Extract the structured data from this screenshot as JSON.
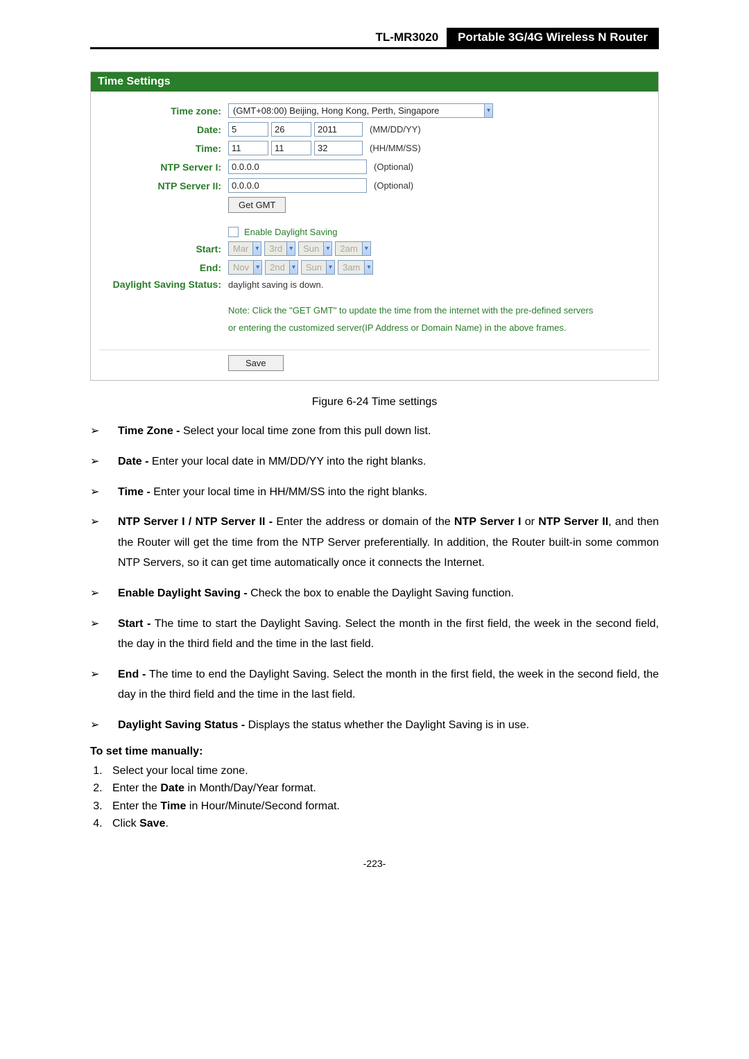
{
  "header": {
    "model": "TL-MR3020",
    "description": "Portable 3G/4G Wireless N Router"
  },
  "panel": {
    "title": "Time Settings",
    "labels": {
      "timezone": "Time zone:",
      "date": "Date:",
      "time": "Time:",
      "ntp1": "NTP Server I:",
      "ntp2": "NTP Server II:",
      "start": "Start:",
      "end": "End:",
      "dss": "Daylight Saving Status:"
    },
    "timezone_value": "(GMT+08:00) Beijing, Hong Kong, Perth, Singapore",
    "date": {
      "m": "5",
      "d": "26",
      "y": "2011",
      "hint": "(MM/DD/YY)"
    },
    "time": {
      "h": "11",
      "mi": "11",
      "s": "32",
      "hint": "(HH/MM/SS)"
    },
    "ntp1_value": "0.0.0.0",
    "ntp2_value": "0.0.0.0",
    "optional": "(Optional)",
    "get_gmt": "Get GMT",
    "enable_ds": "Enable Daylight Saving",
    "start_vals": {
      "a": "Mar",
      "b": "3rd",
      "c": "Sun",
      "d": "2am"
    },
    "end_vals": {
      "a": "Nov",
      "b": "2nd",
      "c": "Sun",
      "d": "3am"
    },
    "dss_value": "daylight saving is down.",
    "note1": "Note: Click the \"GET GMT\" to update the time from the internet with the pre-defined servers",
    "note2": "or entering the customized server(IP Address or Domain Name) in the above frames.",
    "save": "Save"
  },
  "figure_caption": "Figure 6-24    Time settings",
  "bullets": [
    {
      "bold": "Time Zone -",
      "text": " Select your local time zone from this pull down list."
    },
    {
      "bold": "Date -",
      "text": " Enter your local date in MM/DD/YY into the right blanks."
    },
    {
      "bold": "Time -",
      "text": " Enter your local time in HH/MM/SS into the right blanks."
    },
    {
      "bold": "NTP Server I / NTP Server II -",
      "text": " Enter the address or domain of the ",
      "bold2": "NTP Server I",
      "text2": " or ",
      "bold3": "NTP Server II",
      "text3": ", and then the Router will get the time from the NTP Server preferentially. In addition, the Router built-in some common NTP Servers, so it can get time automatically once it connects the Internet."
    },
    {
      "bold": "Enable Daylight Saving -",
      "text": " Check the box to enable the Daylight Saving function."
    },
    {
      "bold": "Start -",
      "text": " The time to start the Daylight Saving. Select the month in the first field, the week in the second field, the day in the third field and the time in the last field."
    },
    {
      "bold": "End -",
      "text": " The time to end the Daylight Saving. Select the month in the first field, the week in the second field, the day in the third field and the time in the last field."
    },
    {
      "bold": "Daylight Saving Status -",
      "text": " Displays the status whether the Daylight Saving is in use."
    }
  ],
  "manual_title": "To set time manually:",
  "steps": [
    {
      "pre": "Select your local time zone."
    },
    {
      "pre": "Enter the ",
      "bold": "Date",
      "post": " in Month/Day/Year format."
    },
    {
      "pre": "Enter the ",
      "bold": "Time",
      "post": " in Hour/Minute/Second format."
    },
    {
      "pre": "Click ",
      "bold": "Save",
      "post": "."
    }
  ],
  "page_num": "-223-"
}
